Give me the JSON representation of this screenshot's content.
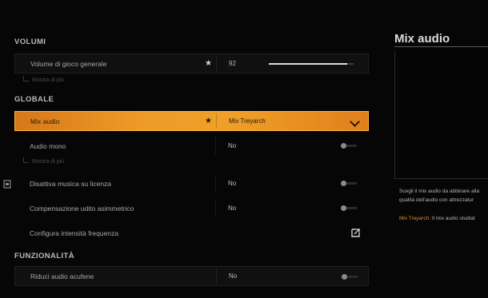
{
  "sections": {
    "volumi": "VOLUMI",
    "globale": "GLOBALE",
    "funzionalita": "FUNZIONALITÀ"
  },
  "rows": {
    "volume_generale": {
      "label": "Volume di gioco generale",
      "value": "92",
      "slider_fraction": 0.92
    },
    "volumi_more": "Mostra di più",
    "mix_audio": {
      "label": "Mix audio",
      "value": "Mix Treyarch"
    },
    "audio_mono": {
      "label": "Audio mono",
      "value": "No"
    },
    "mono_more": "Mostra di più",
    "disattiva_musica": {
      "label": "Disattiva musica su licenza",
      "value": "No"
    },
    "compensazione": {
      "label": "Compensazione udito asimmetrico",
      "value": "No"
    },
    "configura": {
      "label": "Configura intensità frequenza"
    },
    "riduci_acufene": {
      "label": "Riduci audio acufene",
      "value": "No"
    }
  },
  "panel": {
    "title": "Mix audio",
    "desc_line1": "Scegli il mix audio da abbinare alla",
    "desc_line2": "qualità dell'audio con attrezzatur",
    "option_name": "Mix Treyarch:",
    "option_desc": " Il mix audio studiat"
  },
  "colors": {
    "accent": "#f0a028",
    "background": "#060606"
  },
  "icons": {
    "favorite": "star-icon",
    "dropdown": "chevron-down-icon",
    "external": "external-link-icon"
  }
}
